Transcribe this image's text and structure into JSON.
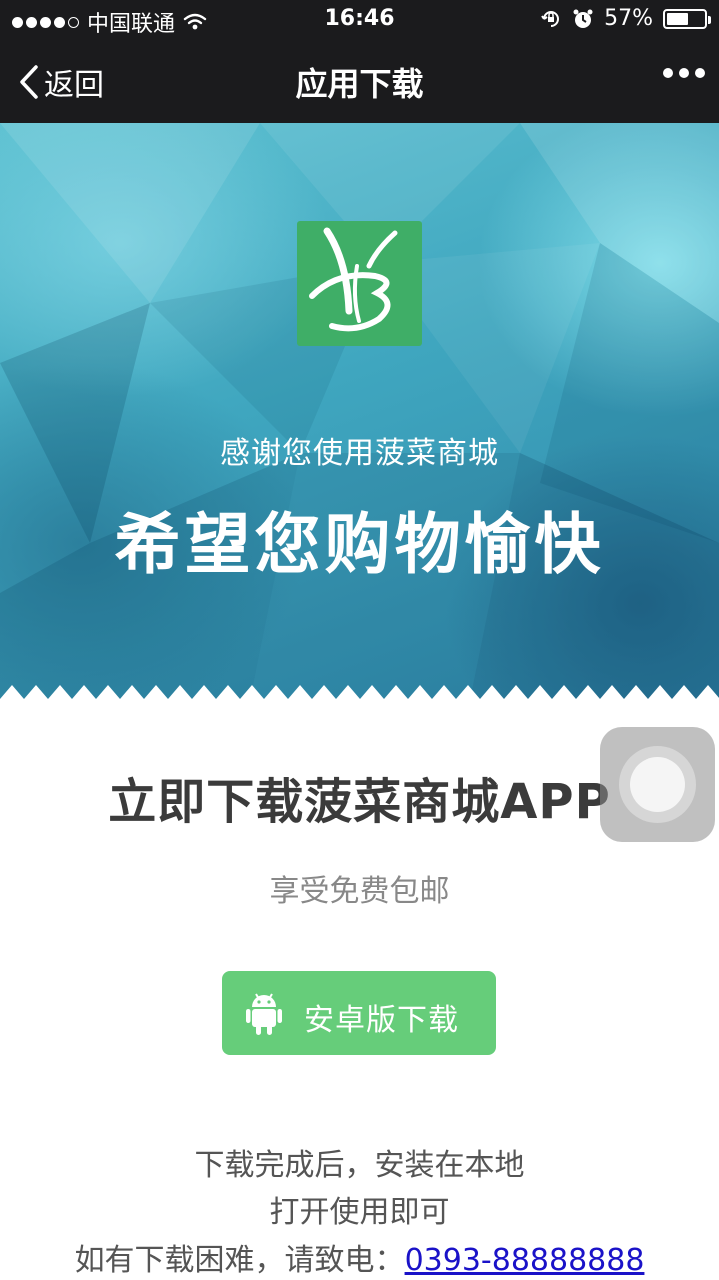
{
  "status_bar": {
    "carrier": "中国联通",
    "time": "16:46",
    "battery_text": "57%",
    "battery_level": 0.57
  },
  "nav": {
    "back_label": "返回",
    "title": "应用下载"
  },
  "hero": {
    "subtitle": "感谢您使用菠菜商城",
    "title": "希望您购物愉快"
  },
  "content": {
    "heading": "立即下载菠菜商城APP",
    "subheading": "享受免费包邮",
    "android_button_label": "安卓版下载",
    "note_line1": "下载完成后，安装在本地",
    "note_line2": "打开使用即可",
    "note_line3_prefix": "如有下载困难，请致电：",
    "phone": "0393-88888888"
  },
  "colors": {
    "bar_bg": "#1b1b1d",
    "logo_green": "#3fae67",
    "button_green": "#66cd7a",
    "link_blue": "#1a12c8"
  },
  "icons": [
    "wifi-icon",
    "orientation-lock-icon",
    "alarm-icon",
    "battery-icon",
    "back-chevron-icon",
    "more-icon",
    "android-icon"
  ]
}
